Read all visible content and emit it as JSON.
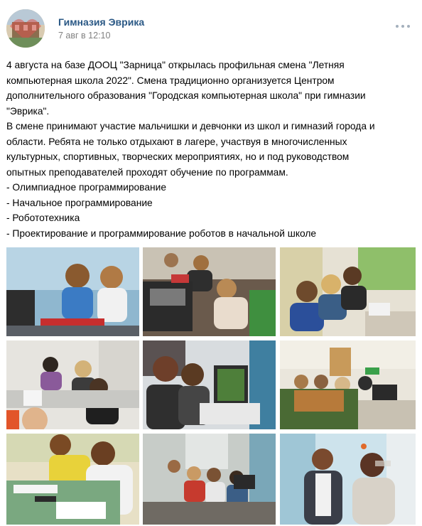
{
  "post": {
    "author": "Гимназия Эврика",
    "date": "7 авг в 12:10",
    "text_lines": [
      "4 августа на базе ДООЦ \"Зарница\" открылась профильная смена \"Летняя",
      "компьютерная школа 2022\". Смена традиционно организуется Центром",
      "дополнительного образования \"Городская компьютерная школа\" при гимназии",
      "\"Эврика\".",
      "В смене принимают участие мальчишки и девчонки из школ и гимназий города и",
      "области. Ребята не только отдыхают в лагере, участвуя в многочисленных",
      "культурных, спортивных, творческих мероприятиях, но и под руководством",
      "опытных преподавателей проходят обучение по программам.",
      "- Олимпиадное программирование",
      "- Начальное программирование",
      "- Робототехника",
      "- Проектирование и программирование роботов в начальной школе"
    ]
  },
  "icons": {
    "more": "more-horizontal-icon"
  },
  "colors": {
    "link": "#2a5885",
    "meta": "#828282",
    "dots": "#a4b0bd"
  },
  "photos": [
    {
      "name": "photo-robotics-kids"
    },
    {
      "name": "photo-robot-kits-table"
    },
    {
      "name": "photo-boys-at-laptops"
    },
    {
      "name": "photo-classroom-group"
    },
    {
      "name": "photo-girls-laptop"
    },
    {
      "name": "photo-hall-teamwork"
    },
    {
      "name": "photo-writing-at-table"
    },
    {
      "name": "photo-group-room"
    },
    {
      "name": "photo-teacher-and-student"
    }
  ]
}
